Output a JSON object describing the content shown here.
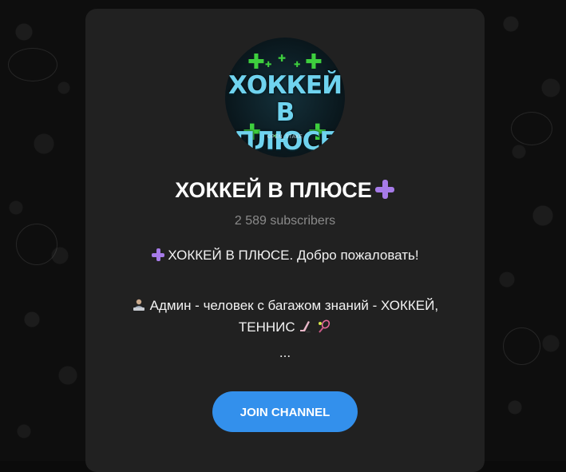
{
  "channel": {
    "avatar": {
      "text_line1": "ХОККЕЙ",
      "text_line2": "В ПЛЮСЕ",
      "small_text": "OPEN_STAKE",
      "accent_color": "#3ecf3e",
      "text_color": "#6fd3ef"
    },
    "title": "ХОККЕЙ В ПЛЮСЕ",
    "title_emoji": "purple-plus-icon",
    "subscribers": "2 589 subscribers",
    "description": {
      "line1": "ХОККЕЙ В ПЛЮСЕ. Добро пожаловать!",
      "line2": "Админ - человек с багажом знаний - ХОККЕЙ,",
      "line3": "ТЕННИС",
      "line4": "..."
    },
    "join_label": "JOIN CHANNEL"
  },
  "colors": {
    "card_background": "#212121",
    "button": "#3390ec",
    "plus_emoji": "#a67be8",
    "subscribers_text": "#8a8a8a"
  }
}
